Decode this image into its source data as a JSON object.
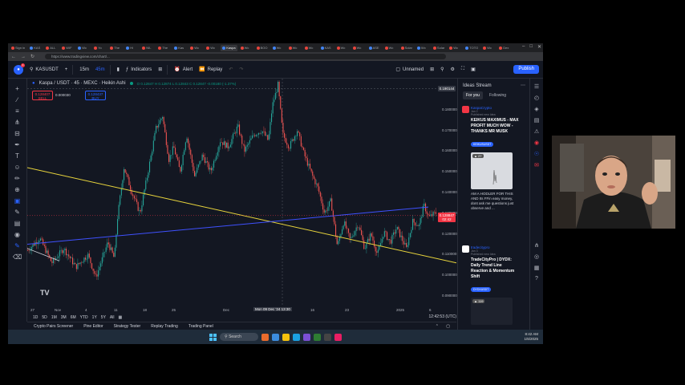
{
  "browser": {
    "tabs": [
      "Sign in",
      "KAS",
      "ALL",
      "WIF",
      "Wc",
      "Yo",
      "The",
      "Hi",
      "NIL",
      "The",
      "Kas",
      "Wc",
      "Wc",
      "Kaspa",
      "Wc",
      "BOO",
      "Wc",
      "Wc",
      "Wc",
      "KAS",
      "Wc",
      "Wc",
      "ASE",
      "Wc",
      "Solar",
      "Wc",
      "Solar",
      "Wc",
      "TOTO",
      "Wc",
      "Dex"
    ],
    "active_tab_index": 13,
    "url": "https://www.tradingview.com/chart/...",
    "window_controls": [
      "–",
      "□",
      "✕"
    ]
  },
  "toolbar": {
    "logo_badge": "1",
    "symbol": "KASUSDT",
    "interval": "15m",
    "interval2": "45m",
    "indicators_label": "Indicators",
    "alert_label": "Alert",
    "replay_label": "Replay",
    "layout_name": "Unnamed",
    "publish_label": "Publish"
  },
  "chart": {
    "title": "Kaspa / USDT · 45 · MEXC · Heikin Ashi",
    "ohlc": "O 0.12847  H 0.12874  L 0.12843  C 0.12847  -0.00180 (-1.37%)",
    "sell_price": "0.128407",
    "sell_label": "SELL",
    "spread": "0.000030",
    "buy_price": "0.128437",
    "buy_label": "BUY",
    "crosshair_price": "0.190144",
    "crosshair_time": "Mon 09 Dec '24  13:30",
    "current_price": "0.128847",
    "current_price_sub": "02:42",
    "price_ticks": [
      "0.180000",
      "0.170000",
      "0.160000",
      "0.150000",
      "0.140000",
      "0.130000",
      "0.120000",
      "0.110000",
      "0.100000",
      "0.090000"
    ],
    "time_ticks": [
      "27",
      "Nov",
      "4",
      "11",
      "18",
      "25",
      "Dec",
      "16",
      "23",
      "2025",
      "6"
    ],
    "ranges": [
      "1D",
      "5D",
      "1M",
      "3M",
      "6M",
      "YTD",
      "1Y",
      "5Y",
      "All"
    ],
    "clock": "12:42:53 (UTC)",
    "line_colors": {
      "yellow": "#e8d43c",
      "blue": "#3f51ff",
      "up": "#26a69a",
      "down": "#ef5350"
    }
  },
  "bottom_panel": [
    "Crypto Pairs Screener",
    "Pine Editor",
    "Strategy Tester",
    "Replay Trading",
    "Trading Panel"
  ],
  "ideas": {
    "header": "Ideas Stream",
    "tabs": [
      "For you",
      "Following"
    ],
    "items": [
      {
        "author": "KaspaCrypto",
        "date": "Jan 2",
        "published": "Published new Idea",
        "title": "KEIKUS MAXIMUS - MAX PROFIT MUCH WOW - THANKS MR MUSK",
        "pill": "KEIKUSUSDT",
        "likes": "27",
        "excerpt": "AM A HODLER FOR THIS AND Its FFin easy money, dont ask me questions just observe and ..."
      },
      {
        "author": "tradecitypro",
        "date": "Jan 3",
        "published": "Published new Idea",
        "title": "TradeCityPro | DYDX: Daily Trend Line Reaction & Momentum Shift",
        "pill": "DYDXUSDT",
        "likes": "119",
        "excerpt": ""
      }
    ]
  },
  "taskbar": {
    "search_label": "Search",
    "time": "8:42 AM",
    "date": "1/6/2025"
  }
}
